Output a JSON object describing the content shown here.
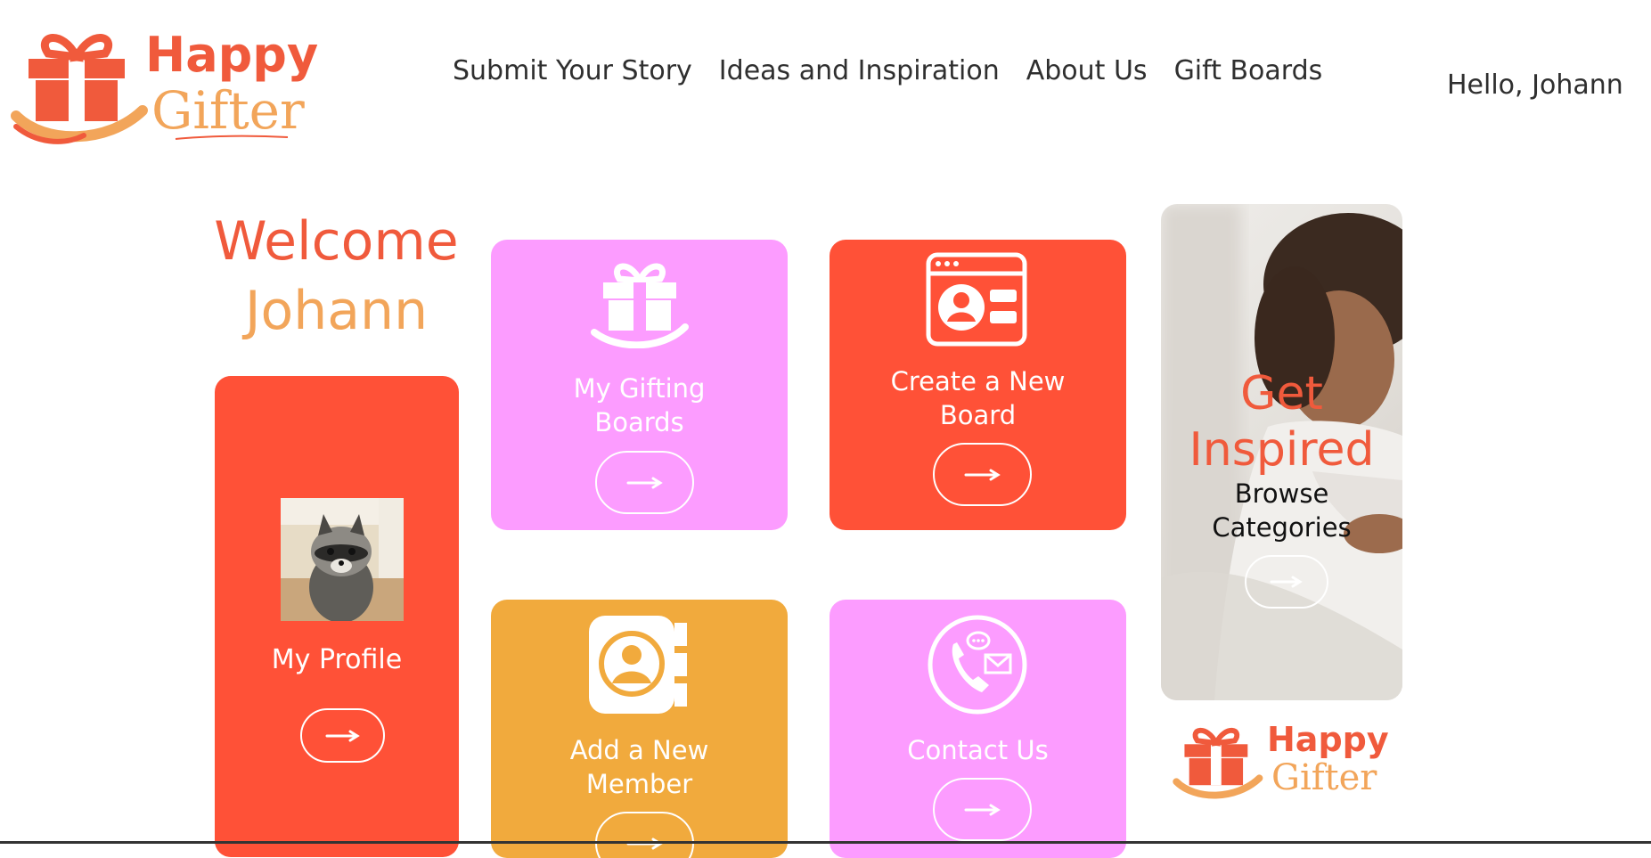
{
  "brand": {
    "word1": "Happy",
    "word2": "Gifter"
  },
  "nav": {
    "items": [
      "Submit Your Story",
      "Ideas and Inspiration",
      "About Us",
      "Gift Boards"
    ],
    "greeting": "Hello, Johann"
  },
  "welcome": {
    "line1": "Welcome",
    "line2": "Johann"
  },
  "cards": {
    "profile": {
      "title": "My Profile",
      "icon": "raccoon-avatar-photo"
    },
    "gifting_boards": {
      "title_line1": "My Gifting",
      "title_line2": "Boards",
      "icon": "gift-hand-icon"
    },
    "new_board": {
      "title_line1": "Create a New",
      "title_line2": "Board",
      "icon": "profile-card-icon"
    },
    "new_member": {
      "title_line1": "Add a New",
      "title_line2": "Member",
      "icon": "address-book-icon"
    },
    "contact": {
      "title": "Contact Us",
      "icon": "phone-contact-icon"
    },
    "inspired": {
      "title_line1": "Get",
      "title_line2": "Inspired",
      "sub_line1": "Browse",
      "sub_line2": "Categories"
    }
  },
  "colors": {
    "red": "#ff5137",
    "pink": "#fc9cff",
    "orange": "#f1aa3d",
    "brand_red": "#f05a3c",
    "brand_orange": "#f2a55a"
  }
}
